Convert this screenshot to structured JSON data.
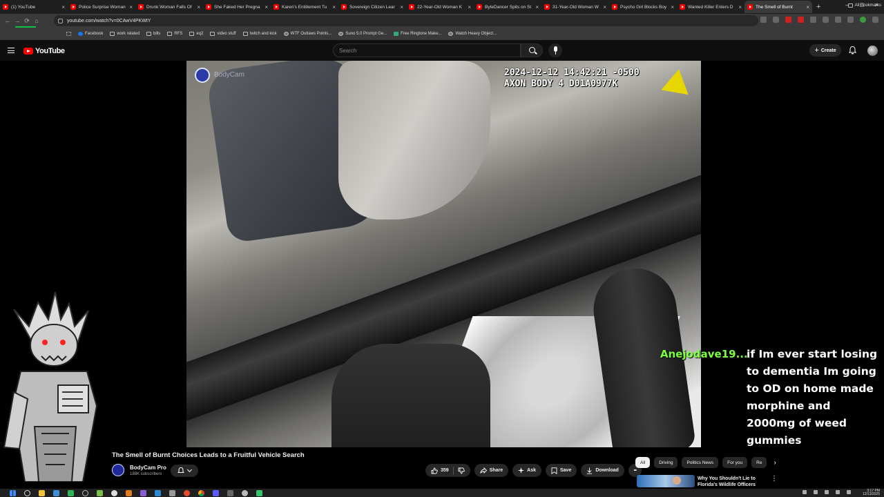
{
  "browser": {
    "tabs": [
      {
        "title": "(1) YouTube",
        "active": false
      },
      {
        "title": "Police Surprise Woman",
        "active": false
      },
      {
        "title": "Drunk Woman Falls Of",
        "active": false
      },
      {
        "title": "She Faked Her Pregna",
        "active": false
      },
      {
        "title": "Karen's Entitlement Tu",
        "active": false
      },
      {
        "title": "Sovereign Citizen Lear",
        "active": false
      },
      {
        "title": "22-Year-Old Woman K",
        "active": false
      },
      {
        "title": "ByteDancer Spits on St",
        "active": false
      },
      {
        "title": "31-Year-Old Woman W",
        "active": false
      },
      {
        "title": "Psycho Girl Blocks Boy",
        "active": false
      },
      {
        "title": "Wanted Killer Enters D",
        "active": false
      },
      {
        "title": "The Smell of Burnt",
        "active": true
      }
    ],
    "close_glyph": "×",
    "new_tab_glyph": "+",
    "window_controls": [
      "–",
      "□",
      "×"
    ],
    "url": "youtube.com/watch?v=0CAwV4PKWtY",
    "nav_glyphs": [
      "←",
      "→",
      "⟳",
      "⌂"
    ],
    "bookmarks": [
      {
        "label": "Facebook",
        "icon": "facebook-icon"
      },
      {
        "label": "work related",
        "icon": "folder-icon"
      },
      {
        "label": "bills",
        "icon": "folder-icon"
      },
      {
        "label": "RFS",
        "icon": "folder-icon"
      },
      {
        "label": "eq2",
        "icon": "folder-icon"
      },
      {
        "label": "video stuff",
        "icon": "folder-icon"
      },
      {
        "label": "twitch and kick",
        "icon": "folder-icon"
      },
      {
        "label": "WTF Outlaws Points...",
        "icon": "site-icon"
      },
      {
        "label": "Suno 5.0 Prompt Ge...",
        "icon": "site-icon"
      },
      {
        "label": "Free Ringtone Make...",
        "icon": "image-icon"
      },
      {
        "label": "Watch Heavy Object...",
        "icon": "site-icon"
      }
    ],
    "all_bookmarks": "All Bookmarks"
  },
  "youtube": {
    "logo_text": "YouTube",
    "search_placeholder": "Search",
    "create_label": "Create",
    "create_glyph": "+"
  },
  "video": {
    "timestamp_line1": "2024-12-12 14:42:21 -0500",
    "timestamp_line2": "AXON BODY 4 D01A0977K",
    "cam_watermark": "BodyCam",
    "title": "The Smell of Burnt Choices Leads to a Fruitful Vehicle Search",
    "channel_name": "BodyCam Pro",
    "subscribers": "188K subscribers",
    "like_count": "359",
    "share_label": "Share",
    "ask_label": "Ask",
    "save_label": "Save",
    "download_label": "Download",
    "more_glyph": "•••"
  },
  "overlay": {
    "chat_username": "Anejodave19...",
    "chat_message": "if Im ever start losing to dementia Im going to OD on home made morphine and 2000mg of weed gummies"
  },
  "sidebar_chips": {
    "chips": [
      "All",
      "Driving",
      "Politics News",
      "For you",
      "Re"
    ],
    "active_index": 0,
    "next_glyph": "›"
  },
  "recommendation": {
    "title": "Why You Shouldn't Lie to Florida's Wildlife Officers"
  },
  "system": {
    "time": "3:17 PM",
    "date": "12/13/2025"
  },
  "colors": {
    "chat_username": "#7cff3c",
    "youtube_red": "#ff0000"
  }
}
